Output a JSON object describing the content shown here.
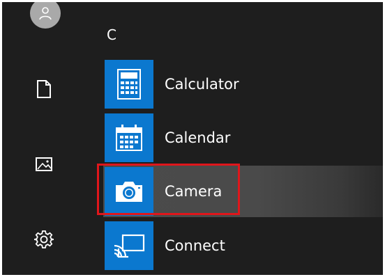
{
  "rail": {
    "items": [
      {
        "icon": "user-avatar-icon"
      },
      {
        "icon": "document-icon"
      },
      {
        "icon": "pictures-icon"
      },
      {
        "icon": "gear-icon"
      }
    ]
  },
  "app_list": {
    "group_letter": "C",
    "apps": [
      {
        "label": "Calculator",
        "icon": "calculator-icon",
        "tile_color": "#0b78cf"
      },
      {
        "label": "Calendar",
        "icon": "calendar-icon",
        "tile_color": "#0b78cf"
      },
      {
        "label": "Camera",
        "icon": "camera-icon",
        "tile_color": "#0b78cf",
        "selected": true
      },
      {
        "label": "Connect",
        "icon": "connect-icon",
        "tile_color": "#0b78cf"
      }
    ]
  },
  "annotation": {
    "highlight_color": "#e0161b",
    "target": "Camera"
  }
}
